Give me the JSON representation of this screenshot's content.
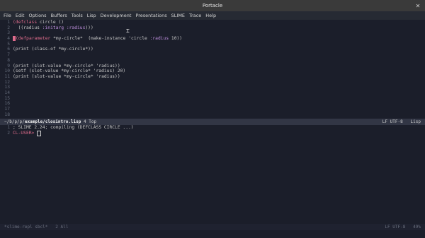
{
  "window": {
    "title": "Portacle",
    "close": "✕"
  },
  "menubar": [
    "File",
    "Edit",
    "Options",
    "Buffers",
    "Tools",
    "Lisp",
    "Development",
    "Presentations",
    "SLIME",
    "Trace",
    "Help"
  ],
  "editor": {
    "lines": [
      {
        "n": "1",
        "parts": [
          [
            "kw",
            "(defclass"
          ],
          [
            "code",
            " circle ()"
          ]
        ]
      },
      {
        "n": "2",
        "parts": [
          [
            "code",
            "  ((radius "
          ],
          [
            "sym",
            ":initarg :radius"
          ],
          [
            "code",
            ")))"
          ]
        ]
      },
      {
        "n": "3",
        "parts": [
          [
            "code",
            ""
          ]
        ]
      },
      {
        "n": "4",
        "parts": [
          [
            "kw",
            "(defparameter"
          ],
          [
            "code",
            " *my-circle*  (make-instance 'circle "
          ],
          [
            "sym",
            ":radius"
          ],
          [
            "code",
            " 10))"
          ]
        ]
      },
      {
        "n": "5",
        "parts": [
          [
            "code",
            ""
          ]
        ]
      },
      {
        "n": "6",
        "parts": [
          [
            "code",
            "(print (class-of *my-circle*))"
          ]
        ]
      },
      {
        "n": "7",
        "parts": [
          [
            "code",
            ""
          ]
        ]
      },
      {
        "n": "8",
        "parts": [
          [
            "code",
            ""
          ]
        ]
      },
      {
        "n": "9",
        "parts": [
          [
            "code",
            "(print (slot-value *my-circle* 'radius))"
          ]
        ]
      },
      {
        "n": "10",
        "parts": [
          [
            "code",
            "(setf (slot-value *my-circle* 'radius) 20)"
          ]
        ]
      },
      {
        "n": "11",
        "parts": [
          [
            "code",
            "(print (slot-value *my-circle* 'radius))"
          ]
        ]
      },
      {
        "n": "12",
        "parts": [
          [
            "code",
            ""
          ]
        ]
      },
      {
        "n": "13",
        "parts": [
          [
            "code",
            ""
          ]
        ]
      },
      {
        "n": "14",
        "parts": [
          [
            "code",
            ""
          ]
        ]
      },
      {
        "n": "15",
        "parts": [
          [
            "code",
            ""
          ]
        ]
      },
      {
        "n": "16",
        "parts": [
          [
            "code",
            ""
          ]
        ]
      },
      {
        "n": "17",
        "parts": [
          [
            "code",
            ""
          ]
        ]
      },
      {
        "n": "18",
        "parts": [
          [
            "code",
            ""
          ]
        ]
      }
    ]
  },
  "modeline": {
    "path_prefix": "~/b/p/p/",
    "path_dir": "example/",
    "file": "closintro.lisp",
    "position": "4 Top",
    "encoding": "LF UTF-8",
    "mode": "Lisp"
  },
  "repl": {
    "line1": "; SLIME 2.24; compiling (DEFCLASS CIRCLE ...)",
    "prompt": "CL-USER>"
  },
  "modeline2": {
    "buffer": "*slime-repl sbcl*",
    "position": "2 All",
    "encoding": "LF UTF-8",
    "zoom": "49%"
  }
}
